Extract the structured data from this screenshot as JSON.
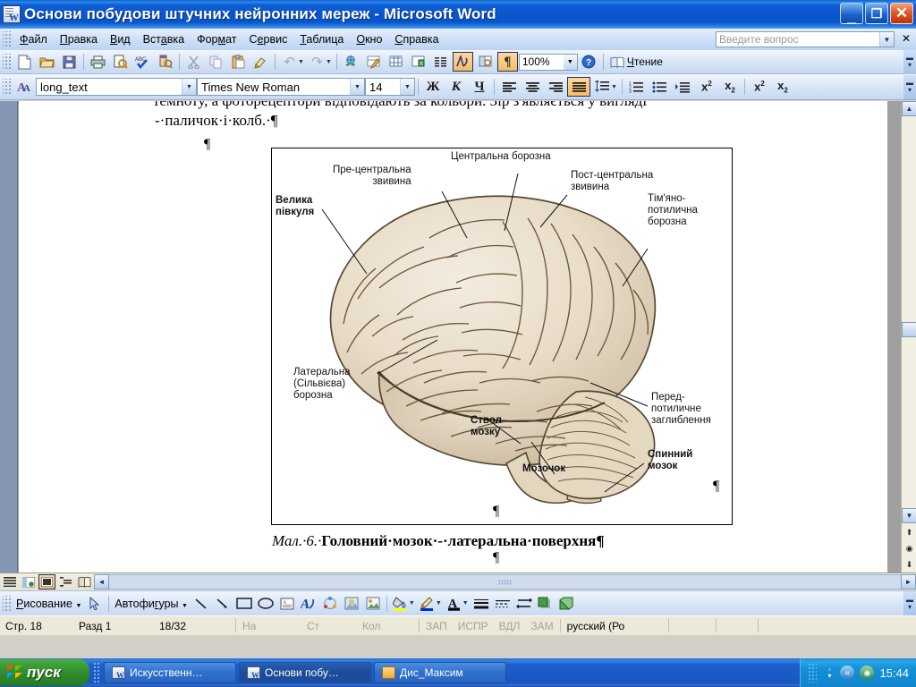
{
  "window": {
    "title": "Основи побудови штучних нейронних мереж - Microsoft Word",
    "icon": "word-document-icon",
    "minimize_label": "_",
    "restore_label": "❐",
    "close_label": "✕"
  },
  "menubar": {
    "items": [
      {
        "label": "Файл",
        "accel": "Ф"
      },
      {
        "label": "Правка",
        "accel": "П"
      },
      {
        "label": "Вид",
        "accel": "В"
      },
      {
        "label": "Вставка",
        "accel": "а"
      },
      {
        "label": "Формат",
        "accel": "м"
      },
      {
        "label": "Сервис",
        "accel": "е"
      },
      {
        "label": "Таблица",
        "accel": "Т"
      },
      {
        "label": "Окно",
        "accel": "О"
      },
      {
        "label": "Справка",
        "accel": "С"
      }
    ],
    "ask_placeholder": "Введите вопрос",
    "ask_dropdown": "▼",
    "close_task_pane": "✕"
  },
  "standard_toolbar": {
    "buttons": [
      {
        "name": "new-document-icon",
        "glyph": "🗋"
      },
      {
        "name": "open-folder-icon",
        "glyph": "📂"
      },
      {
        "name": "save-icon",
        "glyph": "💾"
      },
      {
        "name": "print-icon",
        "glyph": "🖨"
      },
      {
        "name": "print-preview-icon",
        "glyph": "🔍"
      },
      {
        "name": "spellcheck-icon",
        "glyph": "✓"
      },
      {
        "name": "research-icon",
        "glyph": "📑"
      },
      {
        "name": "cut-scissors-icon",
        "glyph": "✂"
      },
      {
        "name": "copy-icon",
        "glyph": "⧉"
      },
      {
        "name": "paste-icon",
        "glyph": "📋"
      },
      {
        "name": "format-painter-icon",
        "glyph": "🖌"
      },
      {
        "name": "undo-icon",
        "glyph": "↶"
      },
      {
        "name": "redo-icon",
        "glyph": "↷"
      },
      {
        "name": "hyperlink-icon",
        "glyph": "🌐"
      },
      {
        "name": "tables-and-borders-icon",
        "glyph": "▦"
      },
      {
        "name": "insert-table-icon",
        "glyph": "▦"
      },
      {
        "name": "insert-excel-sheet-icon",
        "glyph": "▤"
      },
      {
        "name": "columns-icon",
        "glyph": "▥"
      },
      {
        "name": "drawing-icon",
        "glyph": "🅰"
      },
      {
        "name": "document-map-icon",
        "glyph": "🗺"
      },
      {
        "name": "show-formatting-marks-icon",
        "glyph": "¶"
      }
    ],
    "zoom_value": "100%",
    "zoom_dropdown": "▼",
    "help_icon": "?",
    "read_label": "Чтение",
    "read_accel": "Ч",
    "overflow": "▾"
  },
  "formatting_toolbar": {
    "style_value": "long_text",
    "font_value": "Times New Roman",
    "size_value": "14",
    "dropdown_glyph": "▼",
    "bold_label": "Ж",
    "italic_label": "К",
    "underline_label": "Ч",
    "align_left": "≡",
    "align_center": "≡",
    "align_right": "≡",
    "align_justify": "≡",
    "line_spacing": "↕≡",
    "numbering": "⒈",
    "bullets": "•≡",
    "indent": "⇥",
    "superscript": "x²",
    "subscript": "x₂",
    "superscript2": "x²",
    "subscript2": "x₂",
    "overflow": "▾"
  },
  "document": {
    "clipped_line": "темноту, а фоторецептори відповідають за кольори.  Зір з'являється у вигляді",
    "line_2": "-·паличок·і·колб.·¶",
    "pilcrow": "¶",
    "caption_prefix": "Мал.·6.·",
    "caption_text": "Головний·мозок·-·латеральна·поверхня",
    "caption_mark": "¶",
    "figure": {
      "name": "brain-lateral-surface-diagram",
      "labels": [
        {
          "id": "velyka-pivkulya",
          "text": "Велика\nпівкуля",
          "bold": true
        },
        {
          "id": "pre-centralna-zvyvyna",
          "text": "Пре-центральна\nзвивина",
          "bold": false
        },
        {
          "id": "centralna-borozna",
          "text": "Центральна борозна",
          "bold": false
        },
        {
          "id": "post-centralna-zvyvyna",
          "text": "Пост-центральна\nзвивина",
          "bold": false
        },
        {
          "id": "timyano-potylychna-borozna",
          "text": "Тім'яно-\nпотилична\nборозна",
          "bold": false
        },
        {
          "id": "lateralna-silvieva-borozna",
          "text": "Латеральна\n(Сільвієва)\nборозна",
          "bold": false
        },
        {
          "id": "stovbur-mozku",
          "text": "Ствол\nмозку",
          "bold": true
        },
        {
          "id": "mozochok",
          "text": "Мозочок",
          "bold": true
        },
        {
          "id": "pered-potylychne-zaglyblennya",
          "text": "Перед-\nпотиличне\nзаглиблення",
          "bold": false
        },
        {
          "id": "spynnyy-mozok",
          "text": "Спинний\nмозок",
          "bold": true
        }
      ]
    }
  },
  "view_bar": {
    "buttons": [
      {
        "name": "normal-view-icon",
        "glyph": "≣"
      },
      {
        "name": "web-layout-view-icon",
        "glyph": "▣"
      },
      {
        "name": "print-layout-view-icon",
        "glyph": "▤"
      },
      {
        "name": "outline-view-icon",
        "glyph": "⋮≡"
      },
      {
        "name": "reading-layout-view-icon",
        "glyph": "📖"
      }
    ],
    "scroll_left": "◄",
    "scroll_right": "►"
  },
  "drawing_toolbar": {
    "menu_label": "Рисование",
    "menu_accel": "Р",
    "menu_caret": "▾",
    "select-objects": "↖",
    "autoshapes_label": "Автофигуры",
    "autoshapes_caret": "▾",
    "buttons": [
      {
        "name": "line-icon",
        "glyph": "╲"
      },
      {
        "name": "arrow-icon",
        "glyph": "↘"
      },
      {
        "name": "rectangle-icon",
        "glyph": "▭"
      },
      {
        "name": "oval-icon",
        "glyph": "◯"
      },
      {
        "name": "text-box-icon",
        "glyph": "▤"
      },
      {
        "name": "wordart-icon",
        "glyph": "A"
      },
      {
        "name": "diagram-icon",
        "glyph": "❂"
      },
      {
        "name": "clip-art-icon",
        "glyph": "▩"
      },
      {
        "name": "insert-picture-icon",
        "glyph": "🖼"
      },
      {
        "name": "fill-color-icon",
        "glyph": "🪣"
      },
      {
        "name": "line-color-icon",
        "glyph": "🖉"
      },
      {
        "name": "font-color-icon",
        "glyph": "A"
      },
      {
        "name": "line-style-icon",
        "glyph": "≡"
      },
      {
        "name": "dash-style-icon",
        "glyph": "┅"
      },
      {
        "name": "arrow-style-icon",
        "glyph": "⇄"
      },
      {
        "name": "shadow-style-icon",
        "glyph": "▣"
      },
      {
        "name": "3d-style-icon",
        "glyph": "▣"
      }
    ],
    "overflow": "▾"
  },
  "status_bar": {
    "page": "Стр. 18",
    "section": "Разд 1",
    "page_of": "18/32",
    "at": "На",
    "line": "Ст",
    "column": "Кол",
    "rec": "ЗАП",
    "trk": "ИСПР",
    "ext": "ВДЛ",
    "ovr": "ЗАМ",
    "language": "русский (Ро"
  },
  "taskbar": {
    "start_label": "пуск",
    "items": [
      {
        "name": "taskbar-item-word-1",
        "label": "Искусственн…",
        "icon": "word-document-icon"
      },
      {
        "name": "taskbar-item-word-2",
        "label": "Основи побу…",
        "icon": "word-document-icon",
        "active": true
      },
      {
        "name": "taskbar-item-folder",
        "label": "Дис_Максим",
        "icon": "folder-icon"
      }
    ],
    "tray": {
      "show_hidden": "«",
      "network_icon": "◉",
      "clock": "15:44"
    }
  },
  "colors": {
    "titlebar_blue": "#0a55cc",
    "toolbar_blue": "#dbe7f8",
    "highlight_orange": "#f8bc62",
    "status_beige": "#ece9d8",
    "taskbar_blue": "#1a56c0",
    "start_green": "#2f8a2b",
    "brain_fill": "#e6dbc8",
    "brain_outline": "#5a4630"
  }
}
